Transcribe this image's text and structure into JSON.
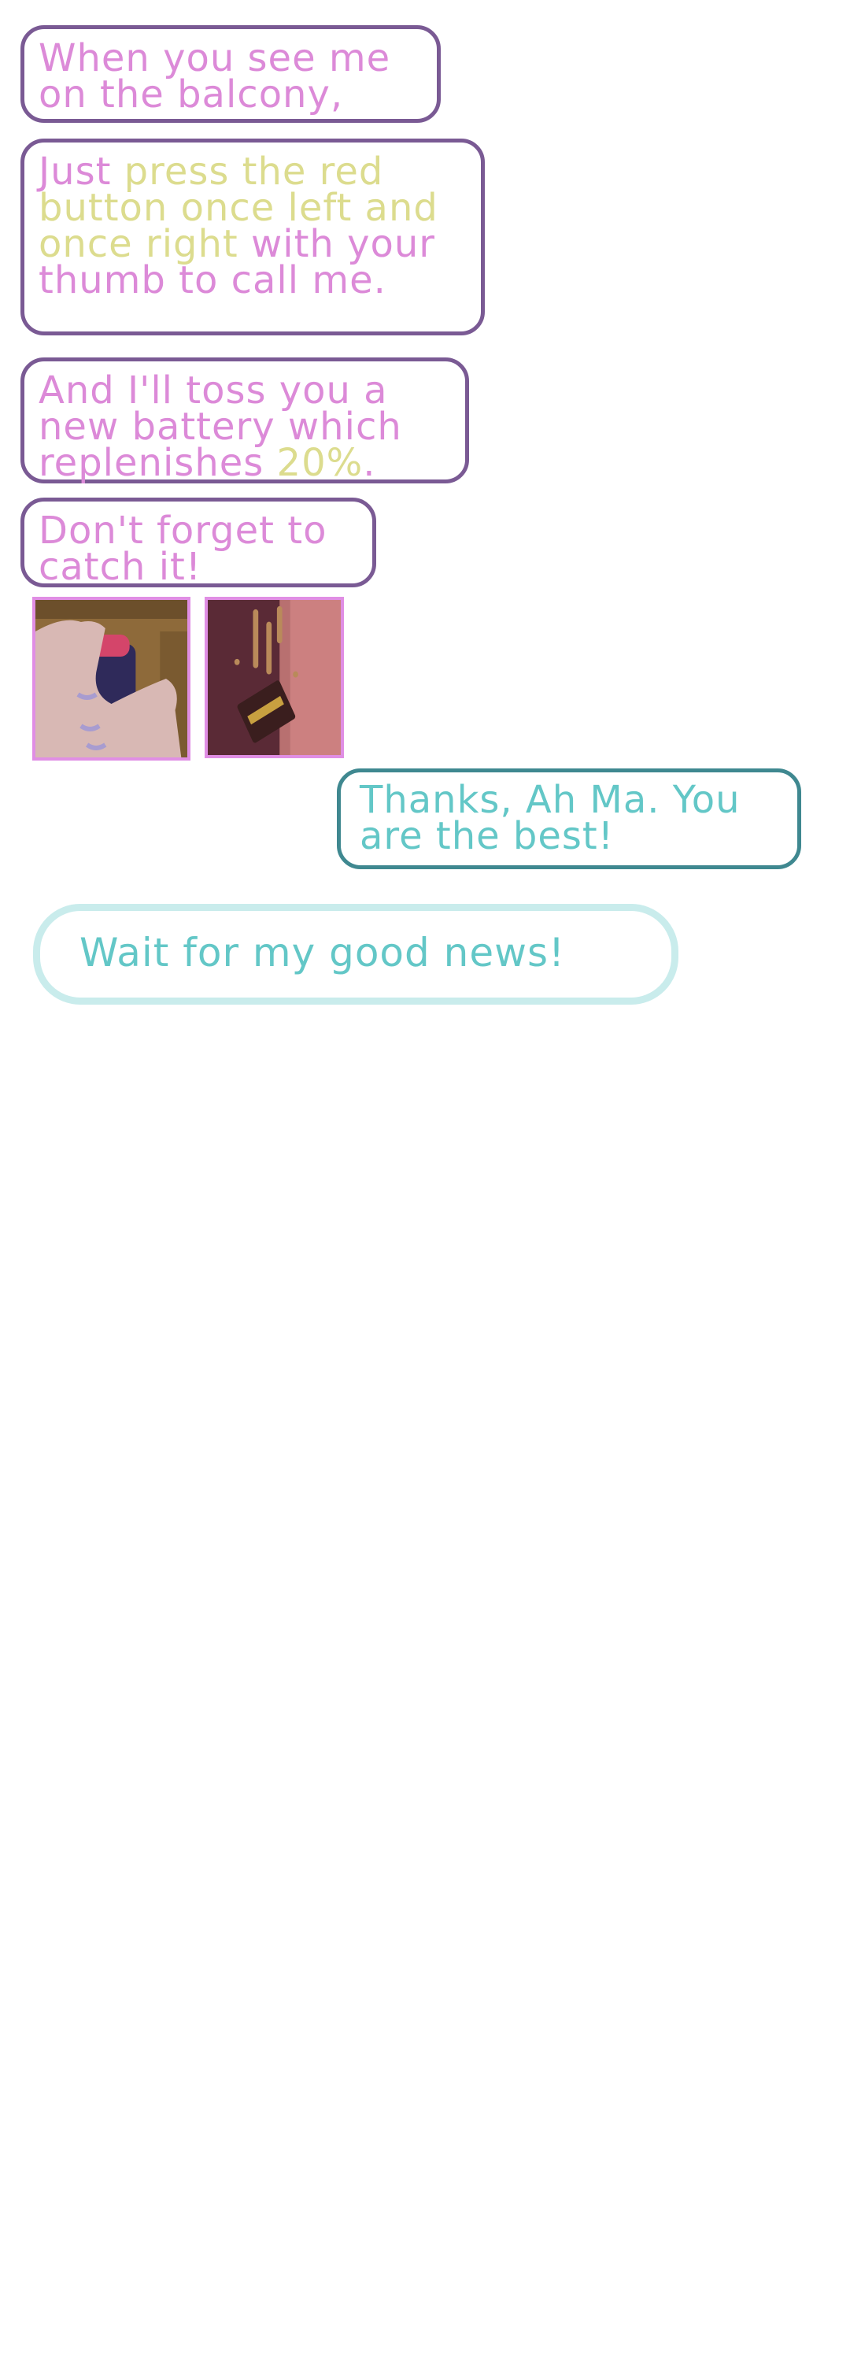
{
  "messages": {
    "m1": {
      "text": "When you see me on the balcony,"
    },
    "m2": {
      "t1": "Just ",
      "t2": "press the red button once left and once right",
      "t3": " with your thumb to call me."
    },
    "m3": {
      "t1": "And I'll toss you a new battery which replenishes ",
      "t2": "20%",
      "t3": "."
    },
    "m4": {
      "text": "Don't forget to catch it!"
    },
    "m5": {
      "text": "Thanks, Ah Ma. You are the best!"
    }
  },
  "reply_option": {
    "text": "Wait for my good news!"
  },
  "colors": {
    "incoming_text": "#dc8ad8",
    "incoming_highlight": "#dcdc8e",
    "incoming_border": "#7a5a94",
    "outgoing_text": "#63c7c7",
    "outgoing_border": "#3f8890",
    "reply_border": "#c9ecec",
    "photo_border": "#e08ee4"
  },
  "attachments": [
    {
      "icon": "thumb-pressing-button-image"
    },
    {
      "icon": "falling-battery-image"
    }
  ]
}
